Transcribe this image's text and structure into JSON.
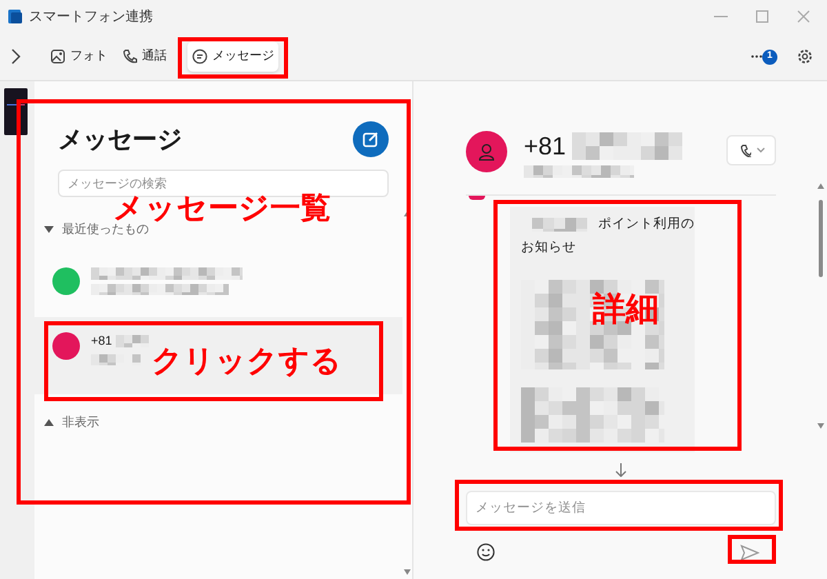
{
  "window": {
    "title": "スマートフォン連携"
  },
  "tabs": [
    {
      "label": "フォト",
      "selected": false
    },
    {
      "label": "通話",
      "selected": false
    },
    {
      "label": "メッセージ",
      "selected": true
    }
  ],
  "notification_badge": "1",
  "conversation_list": {
    "title": "メッセージ",
    "search": {
      "placeholder": "メッセージの検索"
    },
    "groups": [
      {
        "label": "最近使ったもの",
        "expanded": true,
        "conversations": [
          {
            "selected": false,
            "color": "#1fbf60"
          },
          {
            "name": "+81",
            "selected": true,
            "color": "#e3165b"
          }
        ]
      },
      {
        "label": "非表示",
        "expanded": false
      }
    ]
  },
  "conversation": {
    "name": "+81",
    "message": {
      "lines": [
        "ポイント利用の",
        "お知らせ"
      ]
    },
    "compose": {
      "placeholder": "メッセージを送信"
    }
  },
  "annotations": {
    "labels": [
      "メッセージ一覧",
      "クリックする",
      "詳細"
    ]
  }
}
